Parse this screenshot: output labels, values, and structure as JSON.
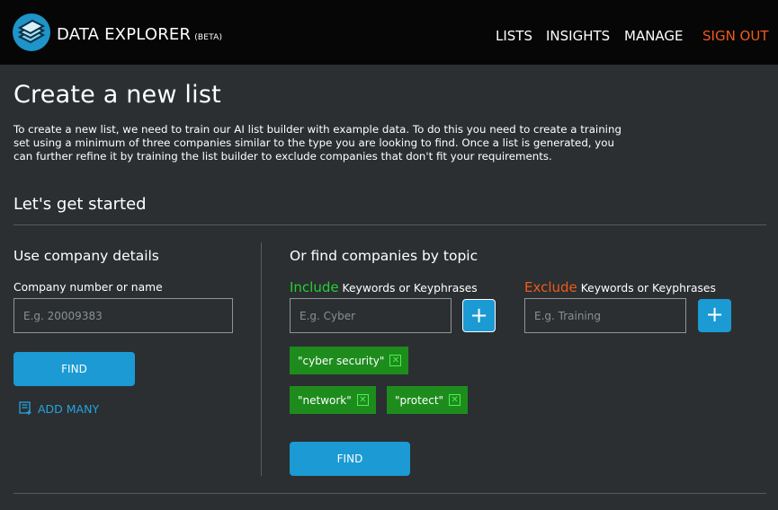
{
  "header": {
    "brand": "DATA EXPLORER",
    "beta": "(BETA)",
    "nav": [
      "LISTS",
      "INSIGHTS",
      "MANAGE"
    ],
    "signout": "SIGN OUT",
    "logo_icon": "stacked-layers-icon"
  },
  "page": {
    "title": "Create a new list",
    "intro": "To create a new list, we need to train our AI list builder with example data. To do this you need to create a training set using a minimum of three companies similar to the type you are looking to find. Once a list is generated, you can further refine it by training the list builder to exclude companies that don't fit your requirements.",
    "section_title": "Let's get started"
  },
  "company": {
    "title": "Use company details",
    "label": "Company number or name",
    "placeholder": "E.g. 20009383",
    "value": "",
    "find": "FIND",
    "add_many": "ADD MANY"
  },
  "topic": {
    "title": "Or find companies by topic",
    "include_word": "Include",
    "include_rest": "Keywords or Keyphrases",
    "include_placeholder": "E.g. Cyber",
    "exclude_word": "Exclude",
    "exclude_rest": "Keywords or Keyphrases",
    "exclude_placeholder": "E.g. Training",
    "plus": "+",
    "tags": [
      "\"cyber security\"",
      "\"network\"",
      "\"protect\""
    ],
    "tag_remove": "✕",
    "find": "FIND"
  },
  "colors": {
    "accent": "#1b9ad4",
    "include": "#22d132",
    "exclude": "#f05a1a",
    "tag_bg": "#1d8c1d"
  }
}
